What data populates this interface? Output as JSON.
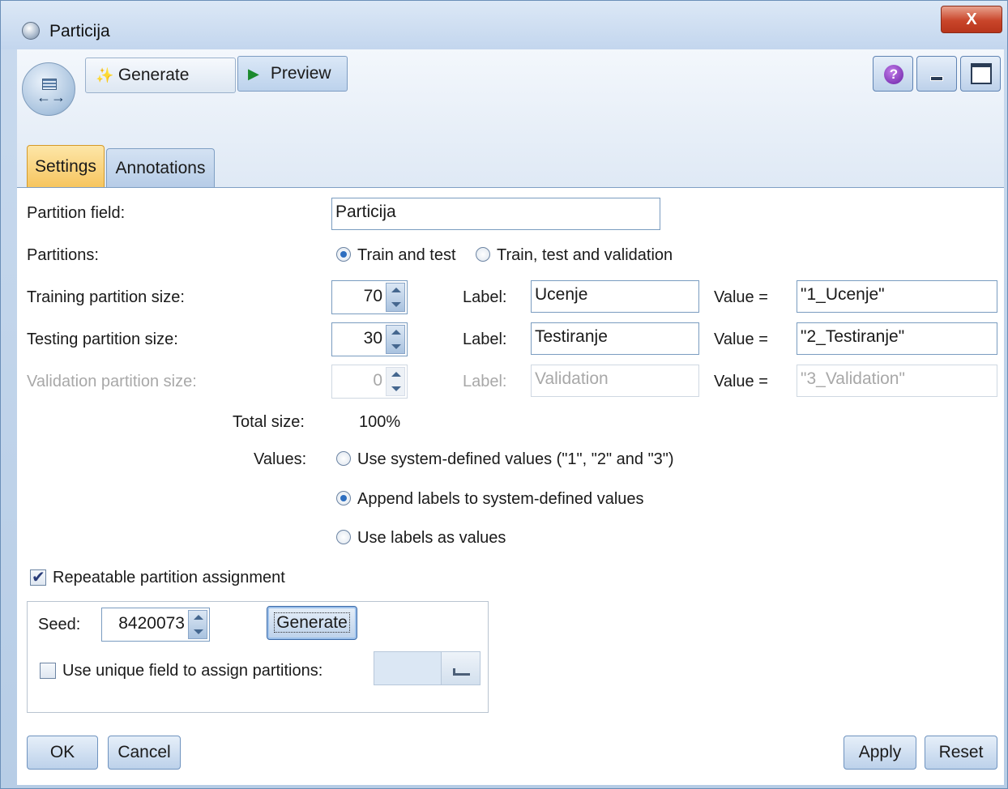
{
  "window": {
    "title": "Particija",
    "close_label": "X"
  },
  "toolbar": {
    "generate_label": "Generate",
    "preview_label": "Preview",
    "help_label": "?"
  },
  "tabs": [
    {
      "label": "Settings",
      "active": true
    },
    {
      "label": "Annotations",
      "active": false
    }
  ],
  "settings": {
    "partition_field_label": "Partition field:",
    "partition_field_value": "Particija",
    "partitions_label": "Partitions:",
    "partitions_options": [
      "Train and test",
      "Train, test and validation"
    ],
    "partitions_selected": "Train and test",
    "rows": [
      {
        "label": "Training partition size:",
        "size": "70",
        "label_text": "Label:",
        "label_value": "Ucenje",
        "value_text": "Value =",
        "value": "\"1_Ucenje\"",
        "enabled": true
      },
      {
        "label": "Testing partition size:",
        "size": "30",
        "label_text": "Label:",
        "label_value": "Testiranje",
        "value_text": "Value =",
        "value": "\"2_Testiranje\"",
        "enabled": true
      },
      {
        "label": "Validation partition size:",
        "size": "0",
        "label_text": "Label:",
        "label_value": "Validation",
        "value_text": "Value =",
        "value": "\"3_Validation\"",
        "enabled": false
      }
    ],
    "total_size_label": "Total size:",
    "total_size_value": "100%",
    "values_label": "Values:",
    "values_options": [
      "Use system-defined values (\"1\", \"2\" and \"3\")",
      "Append labels to system-defined values",
      "Use labels as values"
    ],
    "values_selected": "Append labels to system-defined values",
    "repeatable_label": "Repeatable partition assignment",
    "repeatable_checked": true,
    "seed_label": "Seed:",
    "seed_value": "8420073",
    "seed_generate_label": "Generate",
    "unique_field_label": "Use unique field to assign partitions:",
    "unique_field_checked": false,
    "unique_field_value": ""
  },
  "footer": {
    "ok_label": "OK",
    "cancel_label": "Cancel",
    "apply_label": "Apply",
    "reset_label": "Reset"
  },
  "colors": {
    "accent": "#2e6fc0",
    "active_tab": "#f6c45c",
    "close_button": "#c9452a"
  }
}
